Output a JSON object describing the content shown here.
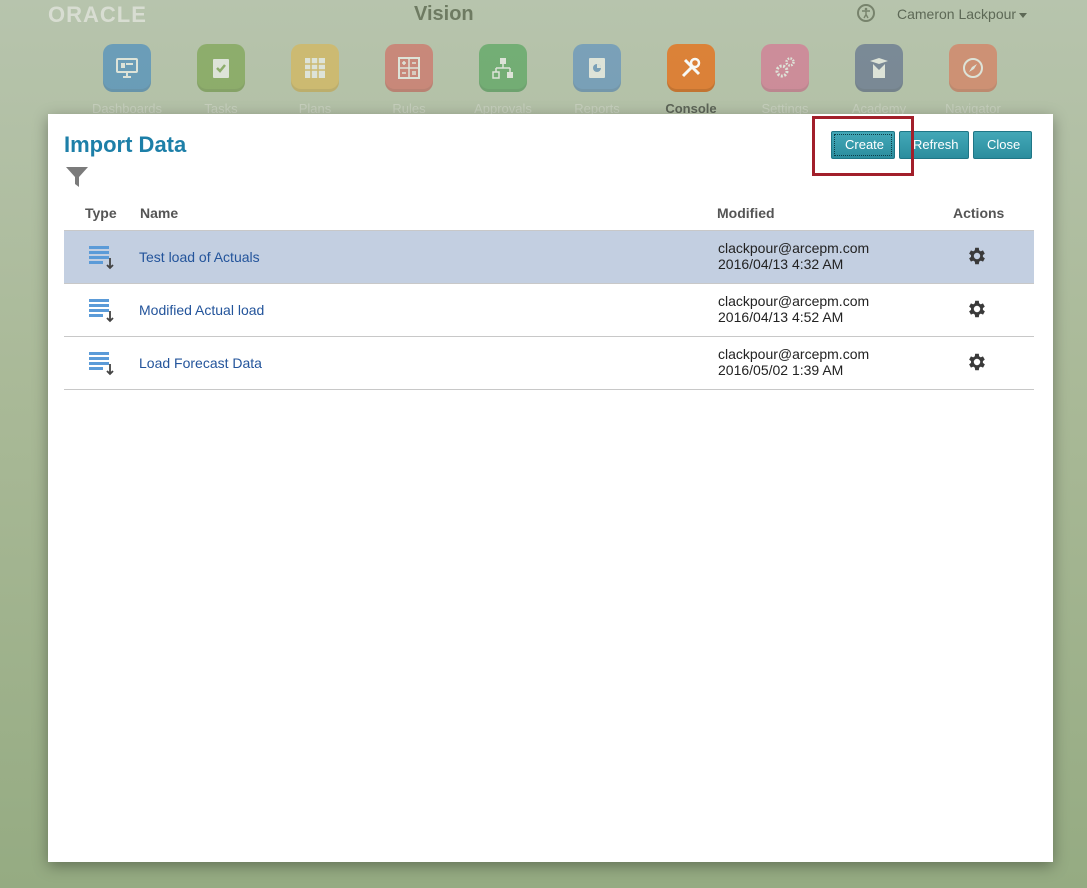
{
  "header": {
    "logo": "ORACLE",
    "app_title": "Vision",
    "user_name": "Cameron Lackpour"
  },
  "nav": {
    "items": [
      {
        "label": "Dashboards",
        "icon": "monitor-icon",
        "color": "#2f7fc4"
      },
      {
        "label": "Tasks",
        "icon": "clipboard-check-icon",
        "color": "#6e9c3a"
      },
      {
        "label": "Plans",
        "icon": "grid-icon",
        "color": "#e0b445"
      },
      {
        "label": "Rules",
        "icon": "calculator-icon",
        "color": "#d95a54"
      },
      {
        "label": "Approvals",
        "icon": "hierarchy-icon",
        "color": "#3e9d4a"
      },
      {
        "label": "Reports",
        "icon": "report-icon",
        "color": "#4a86c4"
      },
      {
        "label": "Console",
        "icon": "tools-icon",
        "color": "#e07b2c"
      },
      {
        "label": "Settings",
        "icon": "gears-icon",
        "color": "#e0628d"
      },
      {
        "label": "Academy",
        "icon": "academy-icon",
        "color": "#4b5c86"
      },
      {
        "label": "Navigator",
        "icon": "compass-icon",
        "color": "#e26a4a"
      }
    ],
    "active": "Console"
  },
  "dialog": {
    "title": "Import Data",
    "buttons": {
      "create": "Create",
      "refresh": "Refresh",
      "close": "Close"
    },
    "columns": {
      "type": "Type",
      "name": "Name",
      "modified": "Modified",
      "actions": "Actions"
    },
    "rows": [
      {
        "name": "Test load of Actuals",
        "modified_by": "clackpour@arcepm.com",
        "modified_at": "2016/04/13 4:32 AM",
        "selected": true
      },
      {
        "name": "Modified Actual load",
        "modified_by": "clackpour@arcepm.com",
        "modified_at": "2016/04/13 4:52 AM",
        "selected": false
      },
      {
        "name": "Load Forecast Data",
        "modified_by": "clackpour@arcepm.com",
        "modified_at": "2016/05/02 1:39 AM",
        "selected": false
      }
    ]
  }
}
